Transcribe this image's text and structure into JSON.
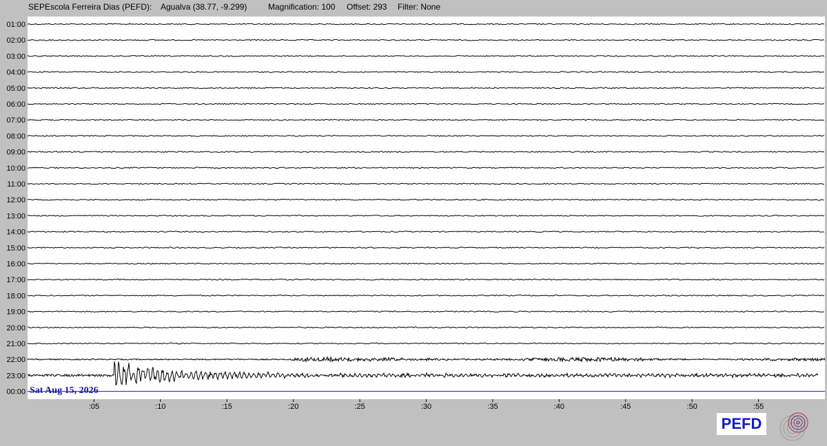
{
  "header": {
    "station": "SEPEscola Ferreira Dias (PEFD):",
    "location": "Agualva (38.77, -9.299)",
    "magnification": "Magnification: 100",
    "offset": "Offset: 293",
    "filter": "Filter: None"
  },
  "logo": {
    "text": "PEFD"
  },
  "colors": {
    "background": "#c0c0c0",
    "plot_background": "#ffffff",
    "trace": "#000000",
    "current_hour_line": "#1a1aa0",
    "logo_text": "#1818c8"
  },
  "chart_data": {
    "type": "line",
    "subtype": "helicorder",
    "row_labels": [
      "01:00",
      "02:00",
      "03:00",
      "04:00",
      "05:00",
      "06:00",
      "07:00",
      "08:00",
      "09:00",
      "10:00",
      "11:00",
      "12:00",
      "13:00",
      "14:00",
      "15:00",
      "16:00",
      "17:00",
      "18:00",
      "19:00",
      "20:00",
      "21:00",
      "22:00",
      "23:00",
      "00:00"
    ],
    "x_tick_labels": [
      ":05",
      ":10",
      ":15",
      ":20",
      ":25",
      ":30",
      ":35",
      ":40",
      ":45",
      ":50",
      ":55"
    ],
    "x_ticks_minutes": [
      5,
      10,
      15,
      20,
      25,
      30,
      35,
      40,
      45,
      50,
      55
    ],
    "xlim_minutes": [
      0,
      60
    ],
    "date_label": "Sat Aug 15, 2026",
    "grid": false,
    "series": [
      {
        "row": "01:00",
        "noise_level": 1.0,
        "end_minute": 60
      },
      {
        "row": "02:00",
        "noise_level": 1.0,
        "end_minute": 60
      },
      {
        "row": "03:00",
        "noise_level": 1.0,
        "end_minute": 60
      },
      {
        "row": "04:00",
        "noise_level": 1.0,
        "end_minute": 60
      },
      {
        "row": "05:00",
        "noise_level": 1.0,
        "end_minute": 60
      },
      {
        "row": "06:00",
        "noise_level": 1.0,
        "end_minute": 60
      },
      {
        "row": "07:00",
        "noise_level": 1.0,
        "end_minute": 60
      },
      {
        "row": "08:00",
        "noise_level": 1.0,
        "end_minute": 60
      },
      {
        "row": "09:00",
        "noise_level": 1.0,
        "end_minute": 60
      },
      {
        "row": "10:00",
        "noise_level": 1.0,
        "end_minute": 60
      },
      {
        "row": "11:00",
        "noise_level": 1.0,
        "end_minute": 60
      },
      {
        "row": "12:00",
        "noise_level": 1.0,
        "end_minute": 60
      },
      {
        "row": "13:00",
        "noise_level": 1.0,
        "end_minute": 60
      },
      {
        "row": "14:00",
        "noise_level": 1.0,
        "end_minute": 60
      },
      {
        "row": "15:00",
        "noise_level": 1.0,
        "end_minute": 60
      },
      {
        "row": "16:00",
        "noise_level": 1.0,
        "end_minute": 60
      },
      {
        "row": "17:00",
        "noise_level": 1.0,
        "end_minute": 60
      },
      {
        "row": "18:00",
        "noise_level": 1.0,
        "end_minute": 60
      },
      {
        "row": "19:00",
        "noise_level": 1.0,
        "end_minute": 60
      },
      {
        "row": "20:00",
        "noise_level": 1.0,
        "end_minute": 60
      },
      {
        "row": "21:00",
        "noise_level": 1.0,
        "end_minute": 60
      },
      {
        "row": "22:00",
        "noise_level": 1.0,
        "end_minute": 60,
        "event_minute": 19.8,
        "event_amplitude": 4,
        "event_decay_minutes": 40
      },
      {
        "row": "23:00",
        "noise_level": 2.0,
        "end_minute": 59.5,
        "event_minute": 6.5,
        "event_amplitude": 20,
        "event_decay_minutes": 15
      },
      {
        "row": "00:00",
        "noise_level": 0,
        "end_minute": 0,
        "current": true
      }
    ]
  }
}
